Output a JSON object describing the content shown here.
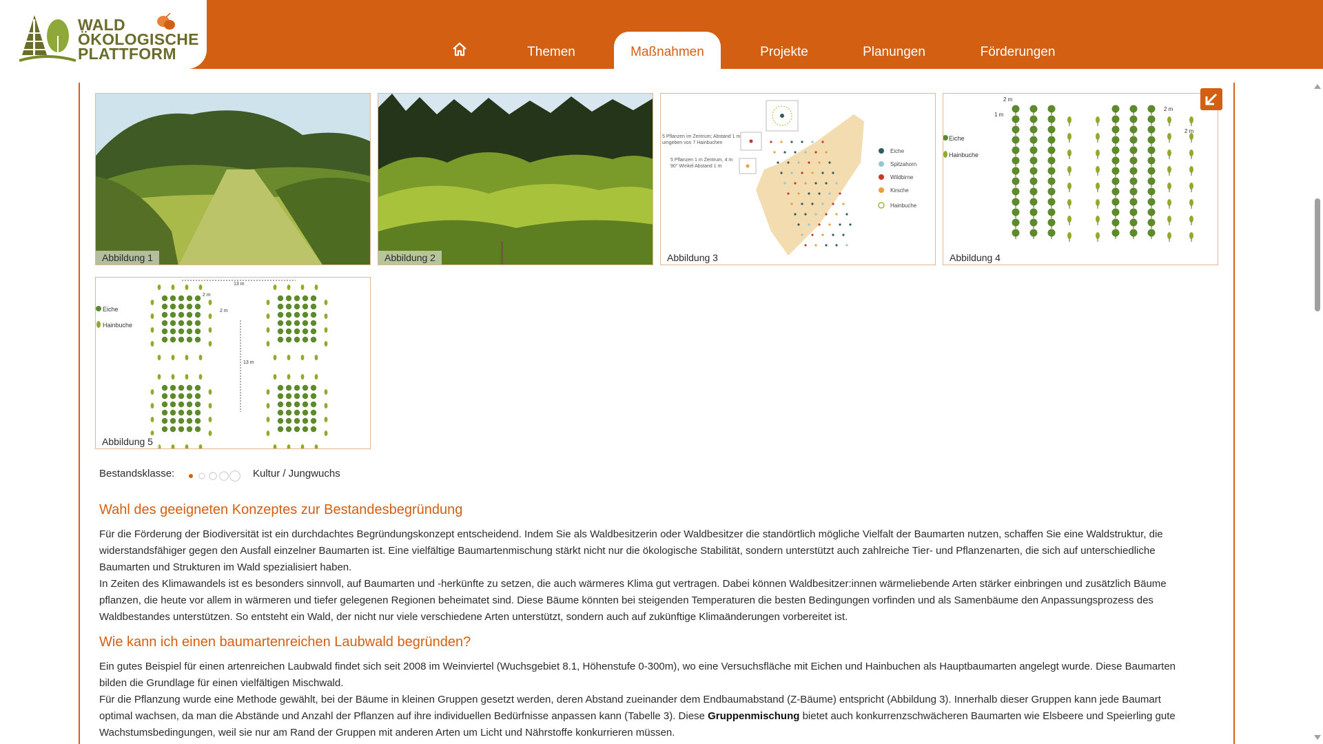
{
  "brand": {
    "logo_line1": "WALD",
    "logo_line2": "ÖKOLOGISCHE",
    "logo_line3": "PLATTFORM",
    "accent": "#d35f12",
    "logo_green": "#6a6c2b"
  },
  "nav": {
    "home_icon": "home-icon",
    "items": [
      {
        "label": "Themen"
      },
      {
        "label": "Maßnahmen",
        "active": true
      },
      {
        "label": "Projekte"
      },
      {
        "label": "Planungen"
      },
      {
        "label": "Förderungen"
      }
    ]
  },
  "gallery": {
    "collapse_icon": "arrow-down-left-icon",
    "figures": [
      {
        "caption": "Abbildung 1"
      },
      {
        "caption": "Abbildung 2"
      },
      {
        "caption": "Abbildung 3",
        "notes": [
          "5 Pflanzen im Zentrum; Abstand 1 m umgeben von 7 Hainbuchen",
          "5 Pflanzen 1 m Zentrum, 4 m 90° Winkel Abstand 1 m"
        ],
        "legend": [
          "Eiche",
          "Spitzahorn",
          "Wildbirne",
          "Kirsche",
          "Hainbuche"
        ]
      },
      {
        "caption": "Abbildung 4",
        "labels": [
          "2 m",
          "1 m",
          "2 m",
          "2 m"
        ],
        "legend": [
          "Eiche",
          "Hainbuche"
        ]
      },
      {
        "caption": "Abbildung 5",
        "labels": [
          "13 m",
          "2 m",
          "2 m",
          "13 m"
        ],
        "legend": [
          "Eiche",
          "Hainbuche"
        ]
      }
    ]
  },
  "stand": {
    "label": "Bestandsklasse:",
    "value": "Kultur / Jungwuchs",
    "level": 1,
    "max": 5
  },
  "section1": {
    "title": "Wahl des geeigneten Konzeptes zur Bestandesbegründung",
    "p1": "Für die Förderung der Biodiversität ist ein durchdachtes Begründungskonzept entscheidend. Indem Sie als Waldbesitzerin oder Waldbesitzer die standörtlich mögliche Vielfalt der Baumarten nutzen, schaffen Sie eine Waldstruktur, die widerstandsfähiger gegen den Ausfall einzelner Baumarten ist. Eine vielfältige Baumartenmischung stärkt nicht nur die ökologische Stabilität, sondern unterstützt auch zahlreiche Tier- und Pflanzenarten, die sich auf unterschiedliche Baumarten und Strukturen im Wald spezialisiert haben.",
    "p2": "In Zeiten des Klimawandels ist es besonders sinnvoll, auf Baumarten und -herkünfte zu setzen, die auch wärmeres Klima gut vertragen. Dabei können Waldbesitzer:innen wärmeliebende Arten stärker einbringen und zusätzlich Bäume pflanzen, die heute vor allem in wärmeren und tiefer gelegenen Regionen beheimatet sind. Diese Bäume könnten bei steigenden Temperaturen die besten Bedingungen vorfinden und als Samenbäume den Anpassungsprozess des Waldbestandes unterstützen. So entsteht ein Wald, der nicht nur viele verschiedene Arten unterstützt, sondern auch auf zukünftige Klimaänderungen vorbereitet ist."
  },
  "section2": {
    "title": "Wie kann ich einen baumartenreichen Laubwald begründen?",
    "p1": "Ein gutes Beispiel für einen artenreichen Laubwald findet sich seit 2008 im Weinviertel (Wuchsgebiet 8.1, Höhenstufe 0-300m), wo eine Versuchsfläche mit Eichen und Hainbuchen als Hauptbaumarten angelegt wurde. Diese Baumarten bilden die Grundlage für einen vielfältigen Mischwald.",
    "p2_before": "Für die Pflanzung wurde eine Methode gewählt, bei der Bäume in kleinen Gruppen gesetzt werden, deren Abstand zueinander dem Endbaumabstand (Z-Bäume) entspricht (Abbildung 3). Innerhalb dieser Gruppen kann jede Baumart optimal wachsen, da man die Abstände und Anzahl der Pflanzen auf ihre individuellen Bedürfnisse anpassen kann (Tabelle 3). Diese ",
    "p2_bold": "Gruppenmischung",
    "p2_after": " bietet auch konkurrenzschwächeren Baumarten wie Elsbeere und Speierling gute Wachstumsbedingungen, weil sie nur am Rand der Gruppen mit anderen Arten um Licht und Nährstoffe konkurrieren müssen."
  }
}
